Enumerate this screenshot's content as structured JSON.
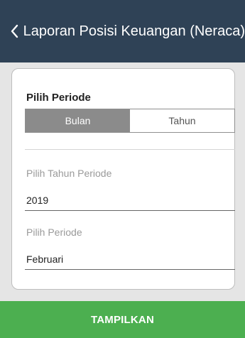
{
  "app_bar": {
    "back_icon": "chevron-left-icon",
    "title": "Laporan Posisi Keuangan (Neraca)"
  },
  "period": {
    "title": "Pilih Periode",
    "segments": [
      {
        "label": "Bulan",
        "selected": true
      },
      {
        "label": "Tahun",
        "selected": false
      }
    ]
  },
  "fields": {
    "year": {
      "label": "Pilih Tahun Periode",
      "value": "2019"
    },
    "period": {
      "label": "Pilih Periode",
      "value": "Februari"
    }
  },
  "actions": {
    "show_label": "TAMPILKAN"
  },
  "colors": {
    "app_bar": "#2f4256",
    "button": "#4caf50",
    "segment_active": "#8b8b8b"
  }
}
